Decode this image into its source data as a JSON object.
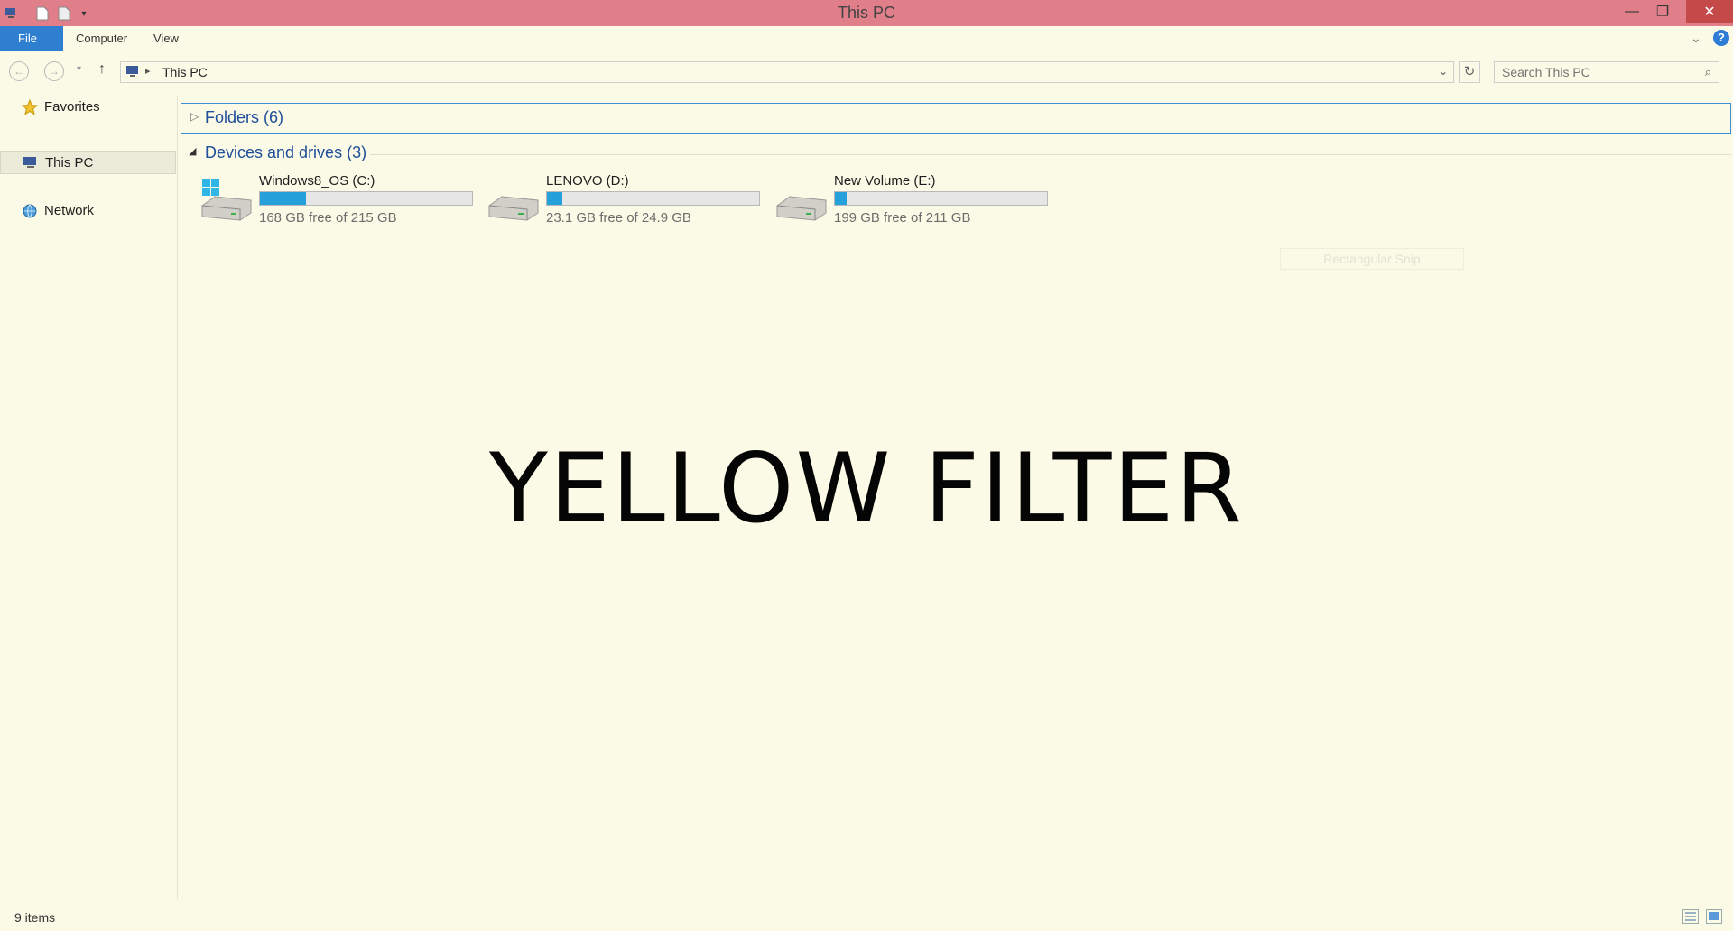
{
  "window": {
    "title": "This PC"
  },
  "ribbon": {
    "tabs": [
      "File",
      "Computer",
      "View"
    ],
    "help": "?"
  },
  "address": {
    "crumb": "This PC",
    "search_placeholder": "Search This PC"
  },
  "nav": {
    "items": [
      "Favorites",
      "This PC",
      "Network"
    ]
  },
  "groups": {
    "folders": "Folders (6)",
    "devices": "Devices and drives (3)"
  },
  "drives": [
    {
      "name": "Windows8_OS (C:)",
      "free": "168 GB free of 215 GB",
      "used_fraction": 0.219,
      "icon": "windows-drive-icon"
    },
    {
      "name": "LENOVO (D:)",
      "free": "23.1 GB free of 24.9 GB",
      "used_fraction": 0.072,
      "icon": "drive-icon"
    },
    {
      "name": "New Volume (E:)",
      "free": "199 GB free of 211 GB",
      "used_fraction": 0.057,
      "icon": "drive-icon"
    }
  ],
  "ghost_label": "Rectangular Snip",
  "overlay_text": "YELLOW FILTER",
  "status": {
    "items": "9 items"
  },
  "colors": {
    "background": "#fafae6",
    "titlebar": "#e07f8a",
    "accent": "#2f7fd0",
    "bar_fill": "#26a0da",
    "group_header": "#1f4e9a"
  }
}
